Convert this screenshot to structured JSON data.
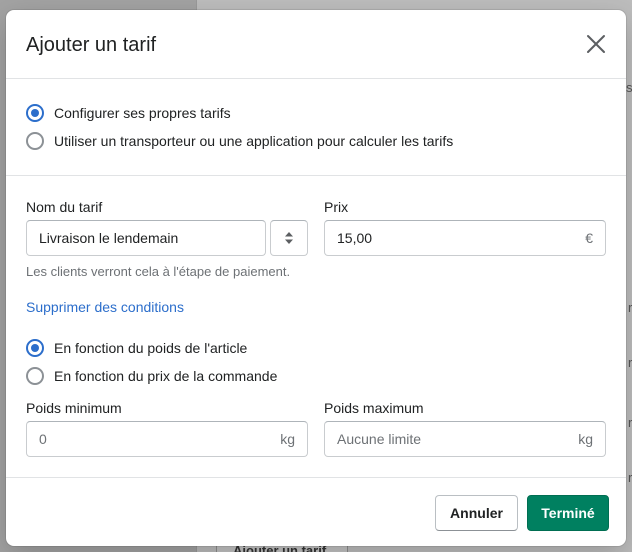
{
  "background": {
    "bottom_button": "Ajouter un tarif",
    "edge_letters": [
      "s",
      "r",
      "r",
      "r",
      "r"
    ]
  },
  "modal": {
    "title": "Ajouter un tarif",
    "rate_type_options": [
      {
        "label": "Configurer ses propres tarifs",
        "checked": true
      },
      {
        "label": "Utiliser un transporteur ou une application pour calculer les tarifs",
        "checked": false
      }
    ],
    "rate_name": {
      "label": "Nom du tarif",
      "value": "Livraison le lendemain",
      "help": "Les clients verront cela à l'étape de paiement."
    },
    "price": {
      "label": "Prix",
      "value": "15,00",
      "currency": "€"
    },
    "remove_conditions_link": "Supprimer des conditions",
    "condition_options": [
      {
        "label": "En fonction du poids de l'article",
        "checked": true
      },
      {
        "label": "En fonction du prix de la commande",
        "checked": false
      }
    ],
    "min_weight": {
      "label": "Poids minimum",
      "placeholder": "0",
      "unit": "kg"
    },
    "max_weight": {
      "label": "Poids maximum",
      "placeholder": "Aucune limite",
      "unit": "kg"
    },
    "footer": {
      "cancel_label": "Annuler",
      "done_label": "Terminé"
    },
    "colors": {
      "primary": "#008060",
      "accent": "#2c6ecb"
    }
  }
}
